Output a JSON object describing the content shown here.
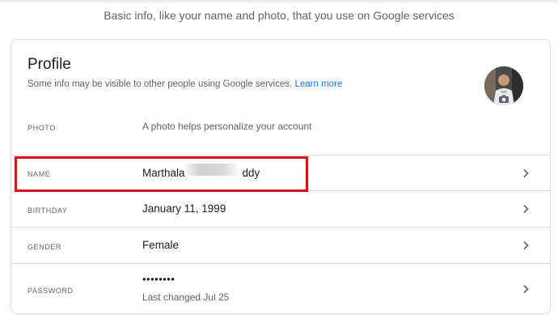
{
  "header": {
    "subtitle": "Basic info, like your name and photo, that you use on Google services"
  },
  "profile": {
    "title": "Profile",
    "description": "Some info may be visible to other people using Google services.",
    "learn_more": "Learn more"
  },
  "rows": {
    "photo": {
      "label": "PHOTO",
      "hint": "A photo helps personalize your account"
    },
    "name": {
      "label": "NAME",
      "value_start": "Marthala",
      "value_end": "ddy"
    },
    "birthday": {
      "label": "BIRTHDAY",
      "value": "January 11, 1999"
    },
    "gender": {
      "label": "GENDER",
      "value": "Female"
    },
    "password": {
      "label": "PASSWORD",
      "value": "••••••••",
      "hint": "Last changed Jul 25"
    }
  },
  "colors": {
    "link": "#1a73e8",
    "highlight": "#d1121f",
    "divider": "#dadce0"
  }
}
